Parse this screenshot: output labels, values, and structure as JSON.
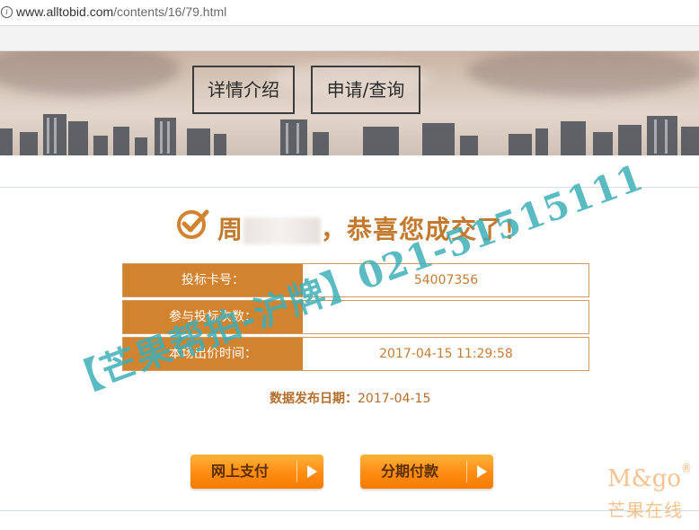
{
  "browser": {
    "url_host": "www.alltobid.com",
    "url_path": "/contents/16/79.html"
  },
  "nav": {
    "details_label": "详情介绍",
    "apply_label": "申请/查询"
  },
  "result": {
    "surname": "周",
    "message": "，恭喜您成交了！"
  },
  "table": [
    {
      "label": "投标卡号：",
      "value": "54007356"
    },
    {
      "label": "参与投标次数：",
      "value": ""
    },
    {
      "label": "本场出价时间：",
      "value": "2017-04-15 11:29:58"
    }
  ],
  "publish": {
    "label": "数据发布日期：",
    "date": "2017-04-15"
  },
  "buttons": {
    "pay_online": "网上支付",
    "installment": "分期付款"
  },
  "watermark": {
    "text": "【芒果帮拍-沪牌】021-51515111"
  },
  "logo": {
    "brand": "M&go",
    "registered": "®",
    "brand_cn": "芒果在线"
  },
  "colors": {
    "accent_orange": "#d2832f",
    "headline": "#c27a2f",
    "watermark": "#3eafb9"
  },
  "icons": [
    "info-icon",
    "check-circle-icon",
    "play-arrow-icon"
  ]
}
